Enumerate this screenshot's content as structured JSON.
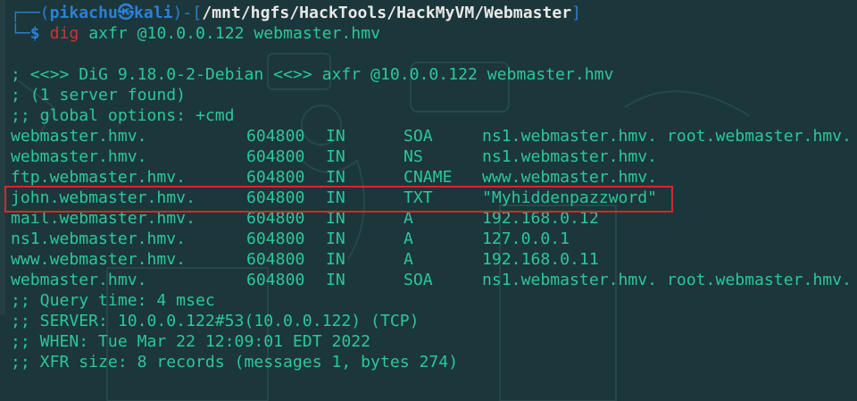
{
  "prompt": {
    "frame_top": "┌──(",
    "user": "pikachu",
    "skull": "㉿",
    "host": "kali",
    "frame_mid": ")-[",
    "path": "/mnt/hgfs/HackTools/HackMyVM/Webmaster",
    "frame_close": "]",
    "frame_bottom": "└─",
    "dollar": "$",
    "command": "dig",
    "args": " axfr @10.0.0.122 webmaster.hmv"
  },
  "output_header": [
    "; <<>> DiG 9.18.0-2-Debian <<>> axfr @10.0.0.122 webmaster.hmv",
    "; (1 server found)",
    ";; global options: +cmd"
  ],
  "records": [
    {
      "name": "webmaster.hmv.",
      "ttl": "604800",
      "class": "IN",
      "type": "SOA",
      "data": "ns1.webmaster.hmv. root.webmaster.hmv."
    },
    {
      "name": "webmaster.hmv.",
      "ttl": "604800",
      "class": "IN",
      "type": "NS",
      "data": "ns1.webmaster.hmv."
    },
    {
      "name": "ftp.webmaster.hmv.",
      "ttl": "604800",
      "class": "IN",
      "type": "CNAME",
      "data": "www.webmaster.hmv."
    },
    {
      "name": "john.webmaster.hmv.",
      "ttl": "604800",
      "class": "IN",
      "type": "TXT",
      "data": "\"Myhiddenpazzword\""
    },
    {
      "name": "mail.webmaster.hmv.",
      "ttl": "604800",
      "class": "IN",
      "type": "A",
      "data": "192.168.0.12"
    },
    {
      "name": "ns1.webmaster.hmv.",
      "ttl": "604800",
      "class": "IN",
      "type": "A",
      "data": "127.0.0.1"
    },
    {
      "name": "www.webmaster.hmv.",
      "ttl": "604800",
      "class": "IN",
      "type": "A",
      "data": "192.168.0.11"
    },
    {
      "name": "webmaster.hmv.",
      "ttl": "604800",
      "class": "IN",
      "type": "SOA",
      "data": "ns1.webmaster.hmv. root.webmaster.hmv."
    }
  ],
  "output_footer": [
    ";; Query time: 4 msec",
    ";; SERVER: 10.0.0.122#53(10.0.0.122) (TCP)",
    ";; WHEN: Tue Mar 22 12:09:01 EDT 2022",
    ";; XFR size: 8 records (messages 1, bytes 274)"
  ],
  "colors": {
    "background": "#1b373b",
    "text": "#2ec69a",
    "highlight_border": "#d8262c",
    "prompt_blue": "#2e7fd4",
    "prompt_red": "#c9353c"
  }
}
